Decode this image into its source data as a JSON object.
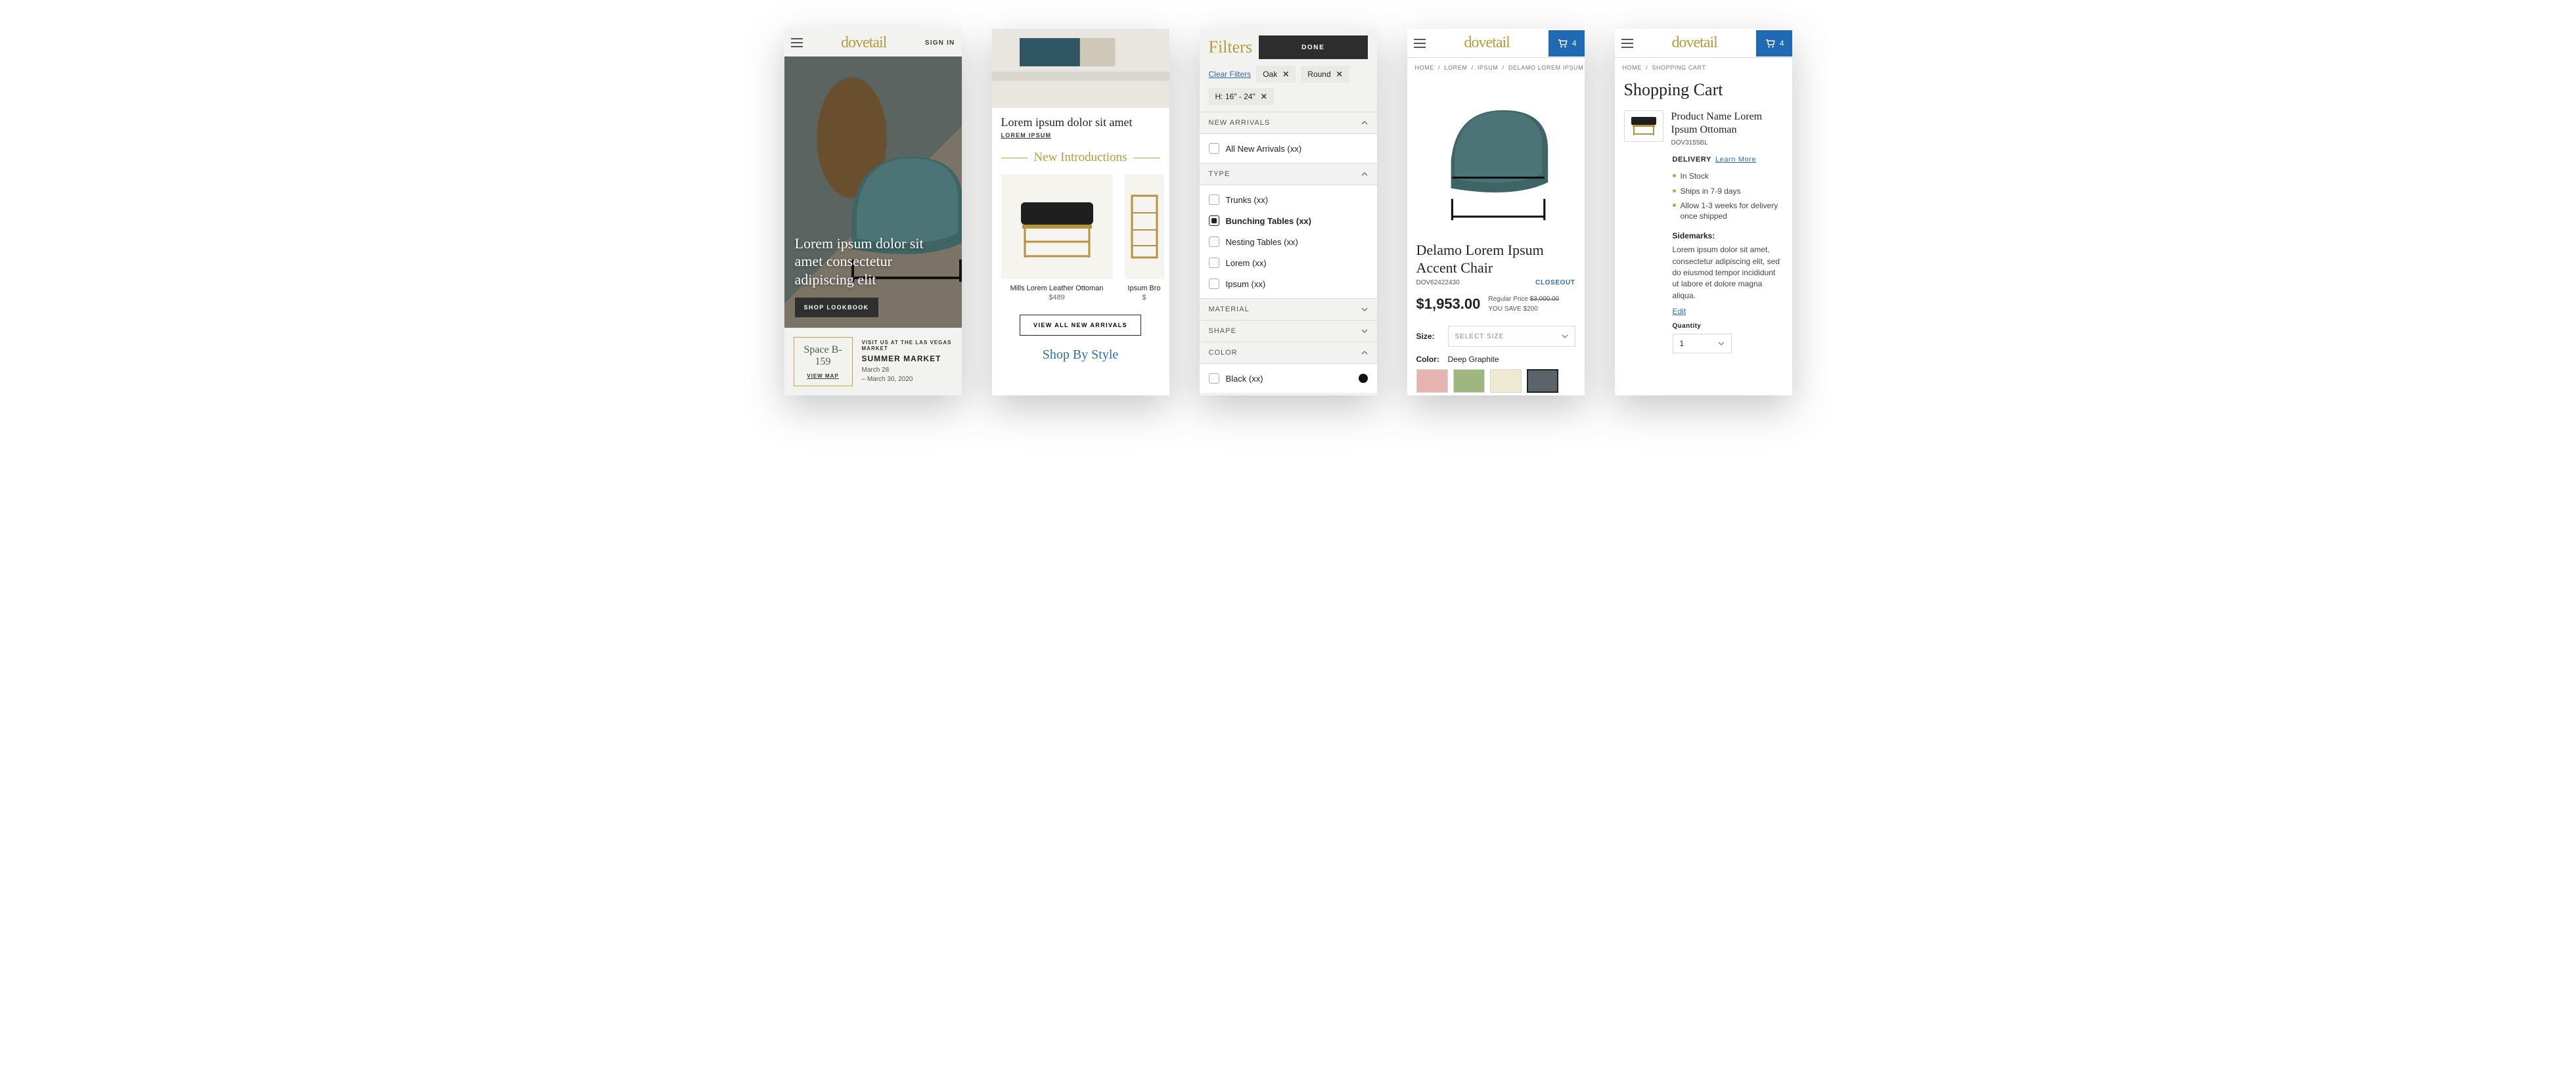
{
  "brand": "dovetail",
  "screen1": {
    "signin": "SIGN IN",
    "hero_text": "Lorem ipsum dolor sit amet consectetur adipiscing elit",
    "hero_cta": "SHOP LOOKBOOK",
    "market_space": "Space B-159",
    "market_map": "VIEW MAP",
    "market_visit": "VISIT US AT THE LAS VEGAS MARKET",
    "market_title": "SUMMER MARKET",
    "market_date1": "March 28",
    "market_date2": "– March 30, 2020"
  },
  "screen2": {
    "headline": "Lorem ipsum dolor sit amet",
    "category": "LOREM IPSUM",
    "section_title": "New Introductions",
    "card1_name": "Mills Lorem Leather Ottoman",
    "card1_price": "$489",
    "card2_name": "Ipsum Bro",
    "card2_price": "$",
    "cta": "VIEW ALL NEW ARRIVALS",
    "next_section": "Shop By Style"
  },
  "screen3": {
    "title": "Filters",
    "done": "DONE",
    "clear": "Clear Filters",
    "chips": {
      "0": "Oak",
      "1": "Round",
      "2": "H: 16\" - 24\""
    },
    "sect_new": "NEW ARRIVALS",
    "opt_all_new": "All New Arrivals (xx)",
    "sect_type": "TYPE",
    "opt_trunks": "Trunks (xx)",
    "opt_bunching": "Bunching Tables (xx)",
    "opt_nesting": "Nesting Tables (xx)",
    "opt_lorem": "Lorem (xx)",
    "opt_ipsum": "Ipsum (xx)",
    "sect_material": "MATERIAL",
    "sect_shape": "SHAPE",
    "sect_color": "COLOR",
    "opt_black": "Black (xx)"
  },
  "screen4": {
    "cart_count": "4",
    "crumbs": {
      "0": "HOME",
      "1": "LOREM",
      "2": "IPSUM",
      "3": "DELAMO LOREM IPSUM ACCENT CHAIR"
    },
    "name": "Delamo Lorem Ipsum Accent Chair",
    "sku": "DOV62422430",
    "closeout": "CLOSEOUT",
    "price": "$1,953.00",
    "reg_label": "Regular Price ",
    "reg_price": "$3,000.00",
    "save": "YOU SAVE $200",
    "size_label": "Size:",
    "size_placeholder": "SELECT SIZE",
    "color_label": "Color:",
    "color_value": "Deep Graphite",
    "swatches": {
      "0": "#e6b4b0",
      "1": "#9fb77e",
      "2": "#efe9d4",
      "3": "#5b6468"
    }
  },
  "screen5": {
    "cart_count": "4",
    "crumbs": {
      "0": "HOME",
      "1": "SHOPPING CART"
    },
    "title": "Shopping Cart",
    "item_name": "Product Name Lorem Ipsum Ottoman",
    "item_sku": "DOV3155BL",
    "delivery": "DELIVERY",
    "learn": "Learn More",
    "bul": {
      "0": "In Stock",
      "1": "Ships in 7-9 days",
      "2": "Allow 1-3 weeks for delivery once shipped"
    },
    "sidemarks_label": "Sidemarks:",
    "sidemarks_text": "Lorem ipsum dolor sit amet, consectetur adipiscing elit, sed do eiusmod tempor incididunt ut labore et dolore magna aliqua.",
    "edit": "Edit",
    "qty_label": "Quantity",
    "qty_value": "1"
  }
}
